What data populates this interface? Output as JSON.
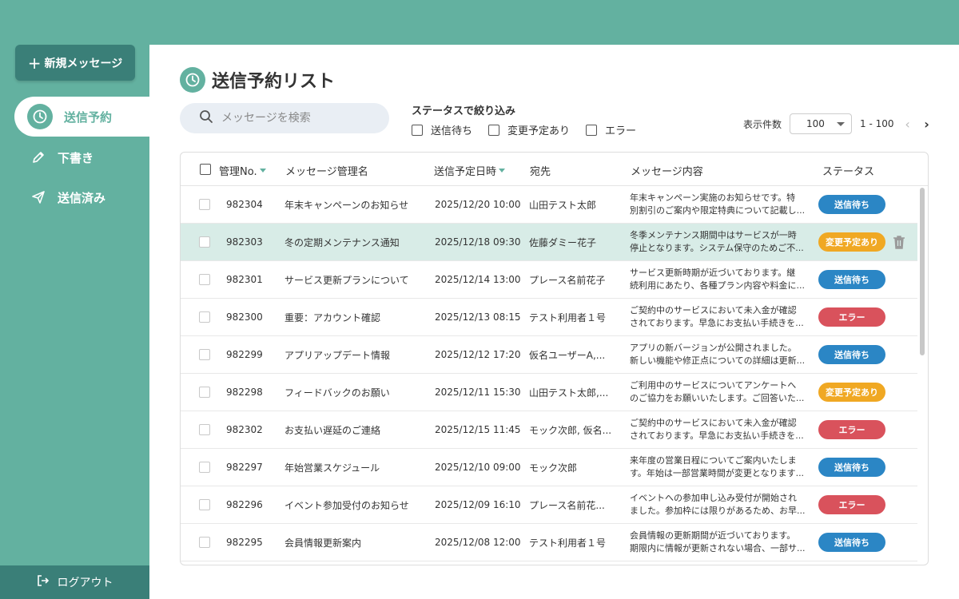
{
  "sidebar": {
    "new_button": "新規メッセージ",
    "items": [
      {
        "label": "送信予約",
        "active": true
      },
      {
        "label": "下書き",
        "active": false
      },
      {
        "label": "送信済み",
        "active": false
      }
    ],
    "logout": "ログアウト"
  },
  "page": {
    "title": "送信予約リスト",
    "search_placeholder": "メッセージを検索",
    "filter_title": "ステータスで絞り込み",
    "filters": [
      "送信待ち",
      "変更予定あり",
      "エラー"
    ],
    "per_page_label": "表示件数",
    "per_page_value": "100",
    "page_range": "1 - 100"
  },
  "table": {
    "headers": {
      "id": "管理No.",
      "name": "メッセージ管理名",
      "date": "送信予定日時",
      "to": "宛先",
      "content": "メッセージ内容",
      "status": "ステータス"
    },
    "rows": [
      {
        "id": "982304",
        "name": "年末キャンペーンのお知らせ",
        "date": "2025/12/20 10:00",
        "to": "山田テスト太郎",
        "content1": "年末キャンペーン実施のお知らせです。特",
        "content2": "別割引のご案内や限定特典について記載し...",
        "status": "送信待ち",
        "status_kind": "waiting"
      },
      {
        "id": "982303",
        "name": "冬の定期メンテナンス通知",
        "date": "2025/12/18 09:30",
        "to": "佐藤ダミー花子",
        "content1": "冬季メンテナンス期間中はサービスが一時",
        "content2": "停止となります。システム保守のためご不...",
        "status": "変更予定あり",
        "status_kind": "changed"
      },
      {
        "id": "982301",
        "name": "サービス更新プランについて",
        "date": "2025/12/14 13:00",
        "to": "プレース名前花子",
        "content1": "サービス更新時期が近づいております。継",
        "content2": "続利用にあたり、各種プラン内容や料金に...",
        "status": "送信待ち",
        "status_kind": "waiting"
      },
      {
        "id": "982300",
        "name": "重要：アカウント確認",
        "date": "2025/12/13 08:15",
        "to": "テスト利用者１号",
        "content1": "ご契約中のサービスにおいて未入金が確認",
        "content2": "されております。早急にお支払い手続きを...",
        "status": "エラー",
        "status_kind": "error"
      },
      {
        "id": "982299",
        "name": "アプリアップデート情報",
        "date": "2025/12/12 17:20",
        "to": "仮名ユーザーA,...",
        "content1": "アプリの新バージョンが公開されました。",
        "content2": "新しい機能や修正点についての詳細は更新...",
        "status": "送信待ち",
        "status_kind": "waiting"
      },
      {
        "id": "982298",
        "name": "フィードバックのお願い",
        "date": "2025/12/11 15:30",
        "to": "山田テスト太郎,...",
        "content1": "ご利用中のサービスについてアンケートへ",
        "content2": "のご協力をお願いいたします。ご回答いた...",
        "status": "変更予定あり",
        "status_kind": "changed"
      },
      {
        "id": "982302",
        "name": "お支払い遅延のご連絡",
        "date": "2025/12/15 11:45",
        "to": "モック次郎, 仮名...",
        "content1": "ご契約中のサービスにおいて未入金が確認",
        "content2": "されております。早急にお支払い手続きを...",
        "status": "エラー",
        "status_kind": "error"
      },
      {
        "id": "982297",
        "name": "年始営業スケジュール",
        "date": "2025/12/10 09:00",
        "to": "モック次郎",
        "content1": "来年度の営業日程についてご案内いたしま",
        "content2": "す。年始は一部営業時間が変更となります...",
        "status": "送信待ち",
        "status_kind": "waiting"
      },
      {
        "id": "982296",
        "name": "イベント参加受付のお知らせ",
        "date": "2025/12/09 16:10",
        "to": "プレース名前花...",
        "content1": "イベントへの参加申し込み受付が開始され",
        "content2": "ました。参加枠には限りがあるため、お早...",
        "status": "エラー",
        "status_kind": "error"
      },
      {
        "id": "982295",
        "name": "会員情報更新案内",
        "date": "2025/12/08 12:00",
        "to": "テスト利用者１号",
        "content1": "会員情報の更新期間が近づいております。",
        "content2": "期限内に情報が更新されない場合、一部サ...",
        "status": "送信待ち",
        "status_kind": "waiting"
      }
    ]
  },
  "colors": {
    "accent": "#63b1a0",
    "accent_dark": "#3a7f78",
    "waiting": "#2b86c5",
    "changed": "#f0a823",
    "error": "#d9525c",
    "row_hover": "#d8ece7"
  },
  "icons": {
    "new": "plus-icon",
    "scheduled": "clock-icon",
    "drafts": "pencil-icon",
    "sent": "paper-plane-icon",
    "logout": "logout-icon",
    "search": "search-icon",
    "delete": "trash-icon",
    "next": "chevron-right-icon",
    "prev": "chevron-left-icon"
  }
}
